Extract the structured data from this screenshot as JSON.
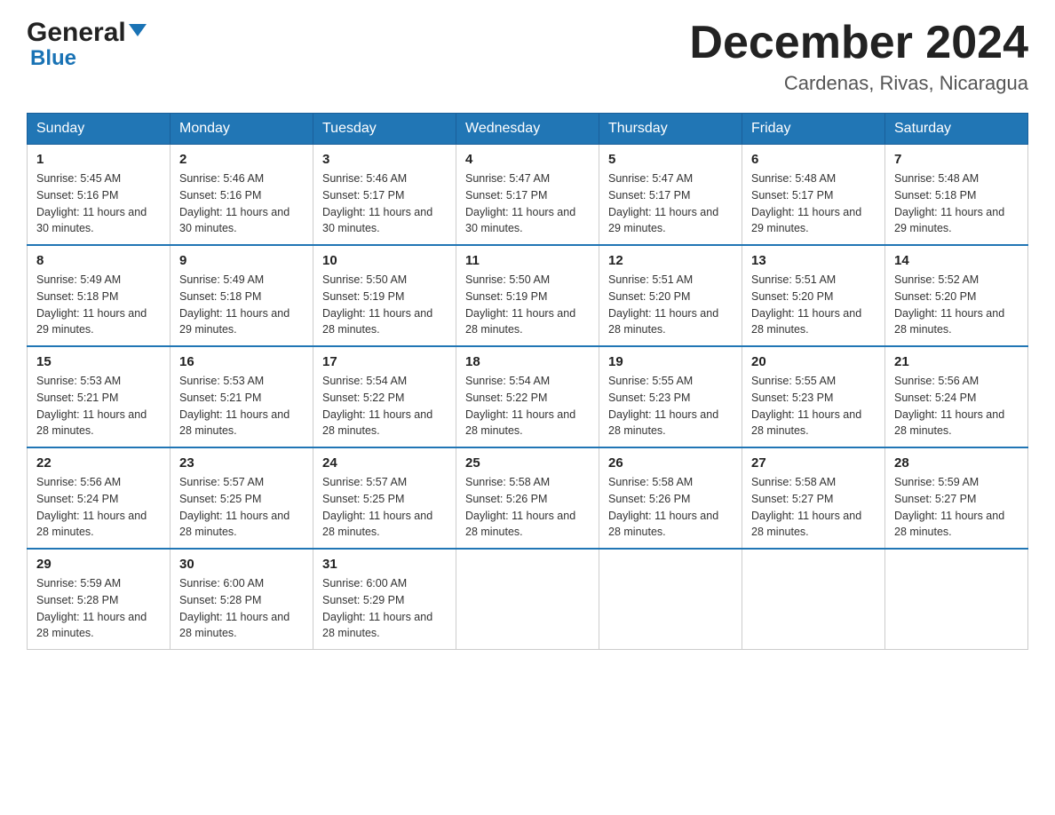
{
  "header": {
    "logo_general": "General",
    "logo_blue": "Blue",
    "month": "December 2024",
    "location": "Cardenas, Rivas, Nicaragua"
  },
  "days_of_week": [
    "Sunday",
    "Monday",
    "Tuesday",
    "Wednesday",
    "Thursday",
    "Friday",
    "Saturday"
  ],
  "weeks": [
    [
      {
        "day": "1",
        "sunrise": "5:45 AM",
        "sunset": "5:16 PM",
        "daylight": "11 hours and 30 minutes."
      },
      {
        "day": "2",
        "sunrise": "5:46 AM",
        "sunset": "5:16 PM",
        "daylight": "11 hours and 30 minutes."
      },
      {
        "day": "3",
        "sunrise": "5:46 AM",
        "sunset": "5:17 PM",
        "daylight": "11 hours and 30 minutes."
      },
      {
        "day": "4",
        "sunrise": "5:47 AM",
        "sunset": "5:17 PM",
        "daylight": "11 hours and 30 minutes."
      },
      {
        "day": "5",
        "sunrise": "5:47 AM",
        "sunset": "5:17 PM",
        "daylight": "11 hours and 29 minutes."
      },
      {
        "day": "6",
        "sunrise": "5:48 AM",
        "sunset": "5:17 PM",
        "daylight": "11 hours and 29 minutes."
      },
      {
        "day": "7",
        "sunrise": "5:48 AM",
        "sunset": "5:18 PM",
        "daylight": "11 hours and 29 minutes."
      }
    ],
    [
      {
        "day": "8",
        "sunrise": "5:49 AM",
        "sunset": "5:18 PM",
        "daylight": "11 hours and 29 minutes."
      },
      {
        "day": "9",
        "sunrise": "5:49 AM",
        "sunset": "5:18 PM",
        "daylight": "11 hours and 29 minutes."
      },
      {
        "day": "10",
        "sunrise": "5:50 AM",
        "sunset": "5:19 PM",
        "daylight": "11 hours and 28 minutes."
      },
      {
        "day": "11",
        "sunrise": "5:50 AM",
        "sunset": "5:19 PM",
        "daylight": "11 hours and 28 minutes."
      },
      {
        "day": "12",
        "sunrise": "5:51 AM",
        "sunset": "5:20 PM",
        "daylight": "11 hours and 28 minutes."
      },
      {
        "day": "13",
        "sunrise": "5:51 AM",
        "sunset": "5:20 PM",
        "daylight": "11 hours and 28 minutes."
      },
      {
        "day": "14",
        "sunrise": "5:52 AM",
        "sunset": "5:20 PM",
        "daylight": "11 hours and 28 minutes."
      }
    ],
    [
      {
        "day": "15",
        "sunrise": "5:53 AM",
        "sunset": "5:21 PM",
        "daylight": "11 hours and 28 minutes."
      },
      {
        "day": "16",
        "sunrise": "5:53 AM",
        "sunset": "5:21 PM",
        "daylight": "11 hours and 28 minutes."
      },
      {
        "day": "17",
        "sunrise": "5:54 AM",
        "sunset": "5:22 PM",
        "daylight": "11 hours and 28 minutes."
      },
      {
        "day": "18",
        "sunrise": "5:54 AM",
        "sunset": "5:22 PM",
        "daylight": "11 hours and 28 minutes."
      },
      {
        "day": "19",
        "sunrise": "5:55 AM",
        "sunset": "5:23 PM",
        "daylight": "11 hours and 28 minutes."
      },
      {
        "day": "20",
        "sunrise": "5:55 AM",
        "sunset": "5:23 PM",
        "daylight": "11 hours and 28 minutes."
      },
      {
        "day": "21",
        "sunrise": "5:56 AM",
        "sunset": "5:24 PM",
        "daylight": "11 hours and 28 minutes."
      }
    ],
    [
      {
        "day": "22",
        "sunrise": "5:56 AM",
        "sunset": "5:24 PM",
        "daylight": "11 hours and 28 minutes."
      },
      {
        "day": "23",
        "sunrise": "5:57 AM",
        "sunset": "5:25 PM",
        "daylight": "11 hours and 28 minutes."
      },
      {
        "day": "24",
        "sunrise": "5:57 AM",
        "sunset": "5:25 PM",
        "daylight": "11 hours and 28 minutes."
      },
      {
        "day": "25",
        "sunrise": "5:58 AM",
        "sunset": "5:26 PM",
        "daylight": "11 hours and 28 minutes."
      },
      {
        "day": "26",
        "sunrise": "5:58 AM",
        "sunset": "5:26 PM",
        "daylight": "11 hours and 28 minutes."
      },
      {
        "day": "27",
        "sunrise": "5:58 AM",
        "sunset": "5:27 PM",
        "daylight": "11 hours and 28 minutes."
      },
      {
        "day": "28",
        "sunrise": "5:59 AM",
        "sunset": "5:27 PM",
        "daylight": "11 hours and 28 minutes."
      }
    ],
    [
      {
        "day": "29",
        "sunrise": "5:59 AM",
        "sunset": "5:28 PM",
        "daylight": "11 hours and 28 minutes."
      },
      {
        "day": "30",
        "sunrise": "6:00 AM",
        "sunset": "5:28 PM",
        "daylight": "11 hours and 28 minutes."
      },
      {
        "day": "31",
        "sunrise": "6:00 AM",
        "sunset": "5:29 PM",
        "daylight": "11 hours and 28 minutes."
      },
      null,
      null,
      null,
      null
    ]
  ],
  "labels": {
    "sunrise": "Sunrise:",
    "sunset": "Sunset:",
    "daylight": "Daylight:"
  }
}
